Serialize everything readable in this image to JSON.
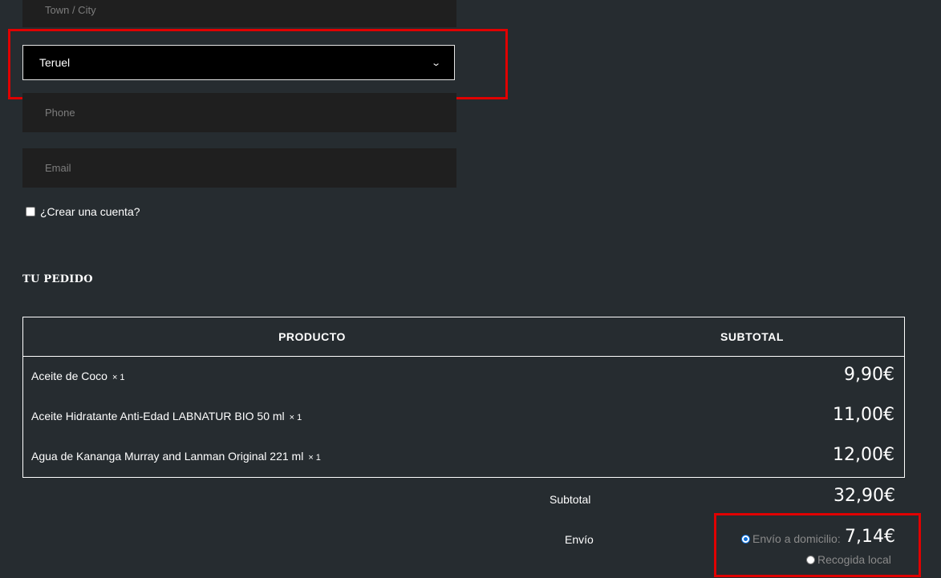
{
  "billing": {
    "town_placeholder": "Town / City",
    "province_selected": "Teruel",
    "phone_placeholder": "Phone",
    "email_placeholder": "Email",
    "create_account_label": "¿Crear una cuenta?"
  },
  "order": {
    "title": "TU PEDIDO",
    "col_product": "PRODUCTO",
    "col_subtotal": "SUBTOTAL",
    "items": [
      {
        "name": "Aceite de Coco",
        "qty": "× 1",
        "price": "9,90€"
      },
      {
        "name": "Aceite Hidratante Anti-Edad LABNATUR BIO 50 ml",
        "qty": "× 1",
        "price": "11,00€"
      },
      {
        "name": "Agua de Kananga Murray and Lanman Original 221 ml",
        "qty": "× 1",
        "price": "12,00€"
      }
    ],
    "subtotal_label": "Subtotal",
    "subtotal_value": "32,90€",
    "shipping_label": "Envío",
    "shipping_options": [
      {
        "label": "Envío a domicilio:",
        "price": "7,14€",
        "selected": true
      },
      {
        "label": "Recogida local",
        "price": "",
        "selected": false
      }
    ]
  },
  "colors": {
    "highlight": "#e00000",
    "background": "#262c30",
    "radio_selected": "#0a6cd6"
  }
}
